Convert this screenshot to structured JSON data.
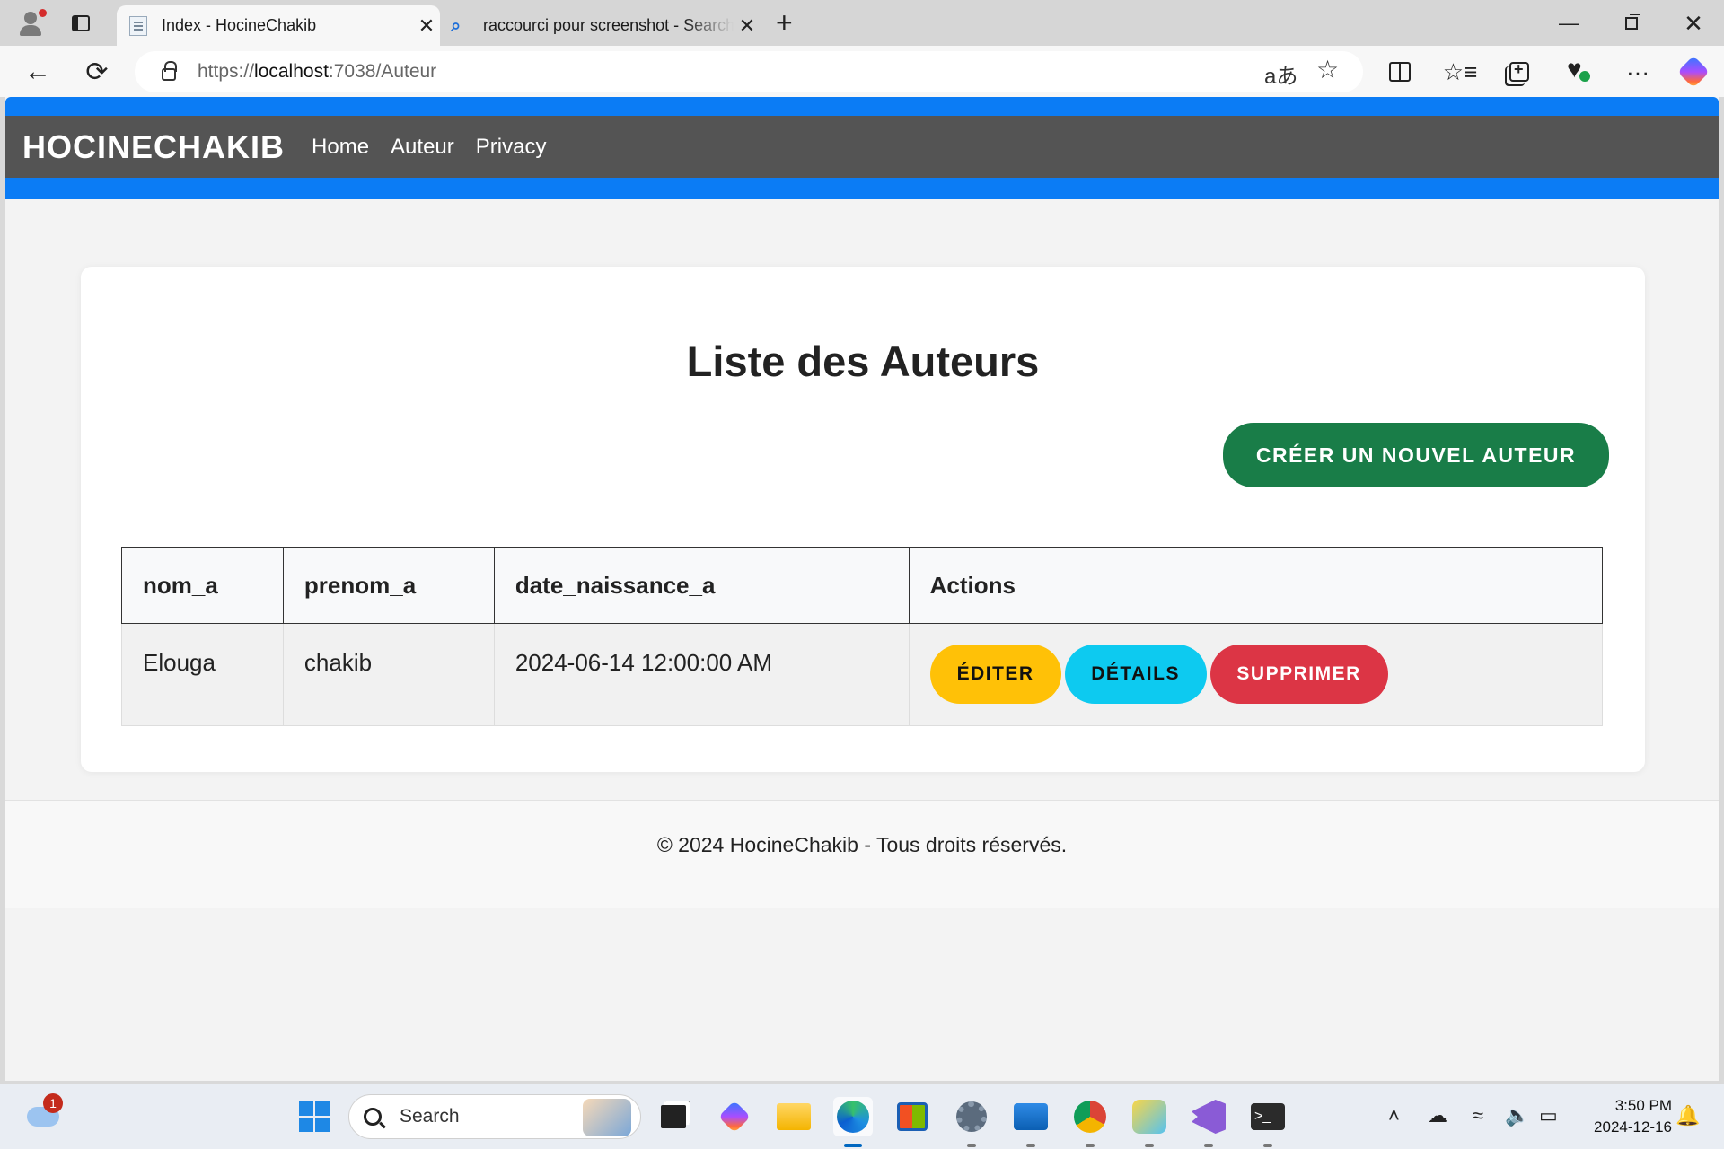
{
  "browser": {
    "tabs": [
      {
        "title": "Index - HocineChakib",
        "active": true
      },
      {
        "title": "raccourci pour screenshot - Search",
        "active": false
      }
    ],
    "url_scheme": "https://",
    "url_host": "localhost",
    "url_rest": ":7038/Auteur",
    "icons": {
      "profile": "profile-icon",
      "tabs": "tab-actions-icon",
      "new_tab": "+",
      "minimize": "—",
      "restore": "restore-icon",
      "close_window": "✕",
      "back": "🡐",
      "reload": "⟳",
      "translate": "aあ",
      "favorite": "☆",
      "more": "···",
      "tab_close": "✕",
      "search_favicon": "🔍"
    }
  },
  "site": {
    "brand": "HOCINECHAKIB",
    "nav": [
      "Home",
      "Auteur",
      "Privacy"
    ],
    "navbar_color": "#545454",
    "accent_color": "#0b7cf5"
  },
  "page": {
    "title": "Liste des Auteurs",
    "create_button": "Créer un nouvel auteur",
    "table": {
      "headers": [
        "nom_a",
        "prenom_a",
        "date_naissance_a",
        "Actions"
      ],
      "rows": [
        {
          "nom_a": "Elouga",
          "prenom_a": "chakib",
          "date_naissance_a": "2024-06-14 12:00:00 AM"
        }
      ],
      "actions": {
        "edit": "Éditer",
        "details": "Détails",
        "delete": "Supprimer"
      }
    },
    "button_colors": {
      "create": "#197d48",
      "edit": "#ffc107",
      "details": "#0dcaf0",
      "delete": "#dc3545"
    }
  },
  "footer": {
    "text": "© 2024 HocineChakib - Tous droits réservés."
  },
  "taskbar": {
    "weather_badge": "1",
    "search_label": "Search",
    "time": "3:50 PM",
    "date": "2024-12-16",
    "apps": [
      "start",
      "task-view",
      "copilot",
      "file-explorer",
      "edge",
      "store",
      "settings",
      "photos",
      "chrome",
      "paint",
      "visual-studio",
      "terminal"
    ]
  }
}
